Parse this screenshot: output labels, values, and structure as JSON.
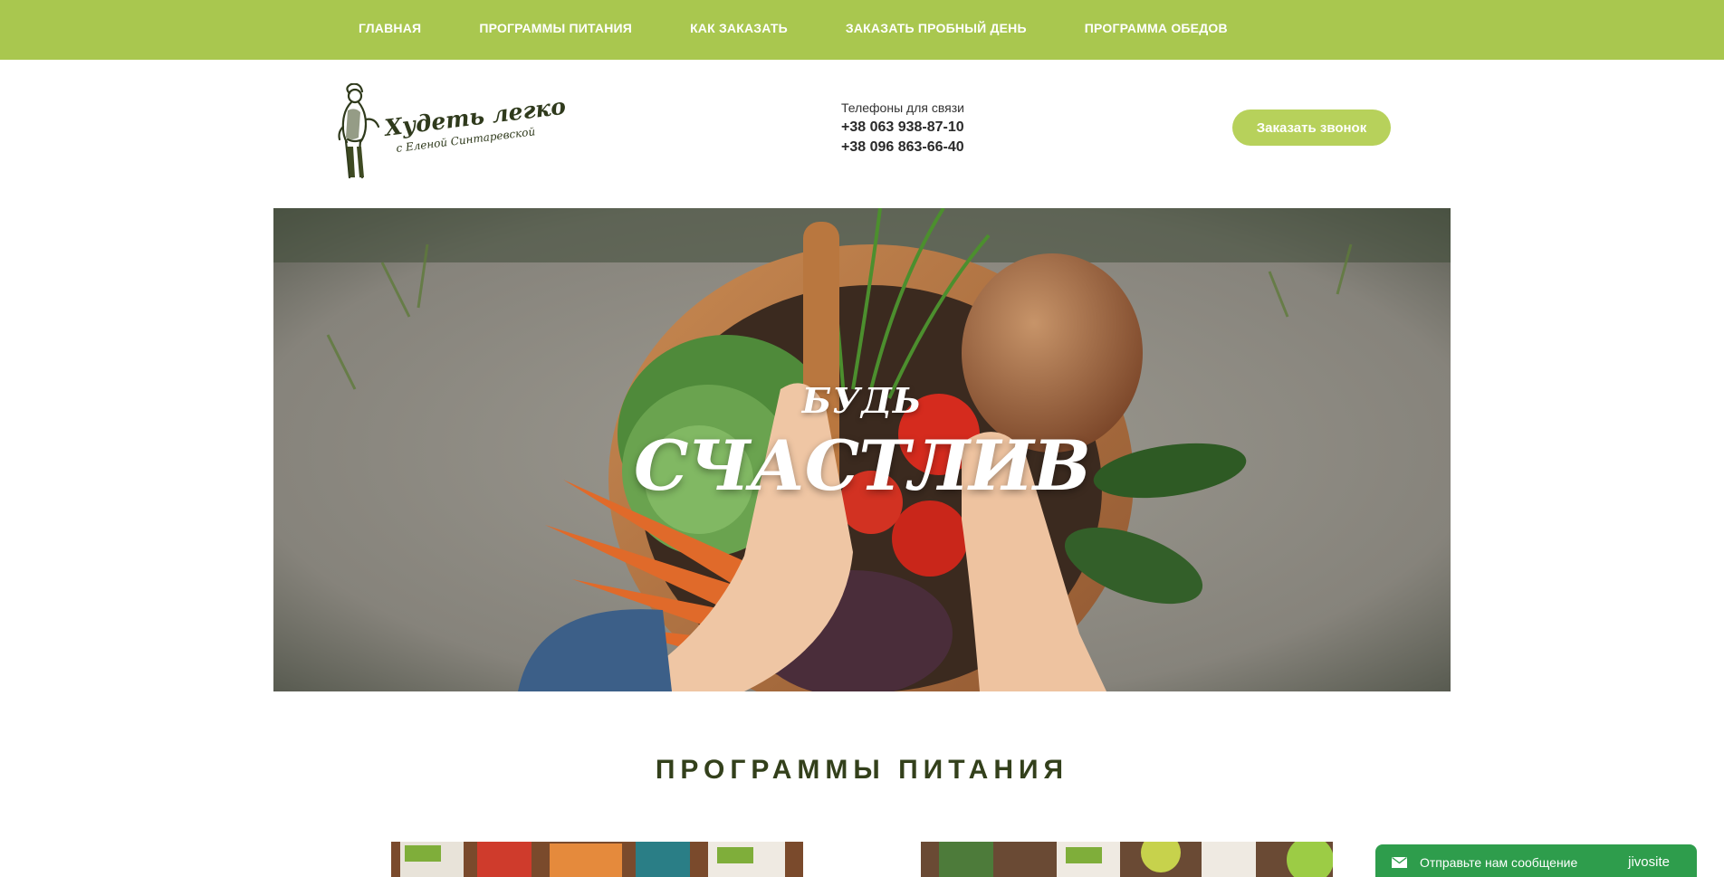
{
  "nav": {
    "items": [
      {
        "label": "ГЛАВНАЯ"
      },
      {
        "label": "ПРОГРАММЫ ПИТАНИЯ"
      },
      {
        "label": "КАК ЗАКАЗАТЬ"
      },
      {
        "label": "ЗАКАЗАТЬ ПРОБНЫЙ ДЕНЬ"
      },
      {
        "label": "ПРОГРАММА ОБЕДОВ"
      }
    ],
    "bg_color": "#a9c74f"
  },
  "logo": {
    "title": "Худеть легко",
    "subtitle": "с Еленой Синтаревской"
  },
  "contacts": {
    "label": "Телефоны для связи",
    "phone1": "+38 063 938-87-10",
    "phone2": "+38 096 863-66-40"
  },
  "callback_button": {
    "label": "Заказать звонок",
    "color": "#b7d15b"
  },
  "hero": {
    "line1": "БУДЬ",
    "line2": "СЧАСТЛИВ"
  },
  "programs": {
    "title": "ПРОГРАММЫ ПИТАНИЯ"
  },
  "chat_widget": {
    "message": "Отправьте нам сообщение",
    "brand": "jivosite",
    "color": "#2e9d4c"
  }
}
